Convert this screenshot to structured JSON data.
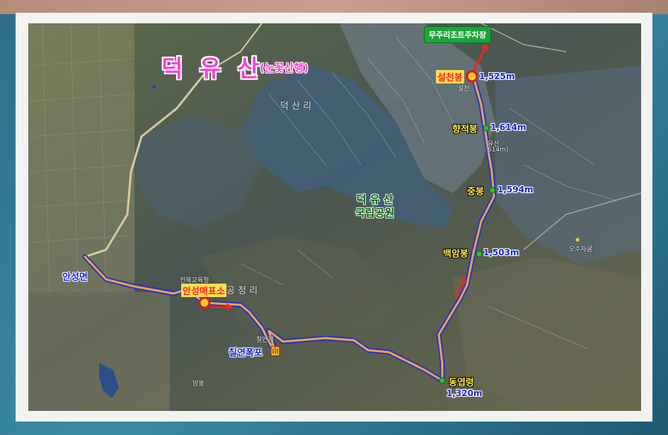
{
  "map": {
    "title": "덕 유 산",
    "subtitle": "(눈꽃산행)",
    "parking_label": "무주리조트주차장",
    "park_label_line1": "덕 유 산",
    "park_label_line2": "국립공원",
    "route_color": "#f2a53a",
    "route_outline_color": "#2234d0",
    "points": [
      {
        "id": "seolcheonbong",
        "name": "설천봉",
        "elevation": "1,525m"
      },
      {
        "id": "hyangjeokbong",
        "name": "향적봉",
        "elevation": "1,614m"
      },
      {
        "id": "jungbong",
        "name": "중봉",
        "elevation": "1,594m"
      },
      {
        "id": "baegambong",
        "name": "백암봉",
        "elevation": "1,503m"
      },
      {
        "id": "dongyeopryeong",
        "name": "동엽령",
        "elevation": "1,320m"
      },
      {
        "id": "anseong-ticket",
        "name": "안성매표소",
        "elevation": ""
      },
      {
        "id": "chilyeon-falls",
        "name": "칠연폭포",
        "elevation": ""
      }
    ],
    "place_anseongmyeon": "안성면",
    "faint_labels": {
      "deoksanri": "덕 산 리",
      "gongjeongri": "공 정 리",
      "education_office": "전북교육청",
      "chilyeongye": "칠연계",
      "mangbong": "망봉",
      "osujagul": "오수자굴",
      "seolcheon_small": "설천",
      "yusan_small": "유산",
      "yusan_elev_small": "614m)"
    }
  }
}
